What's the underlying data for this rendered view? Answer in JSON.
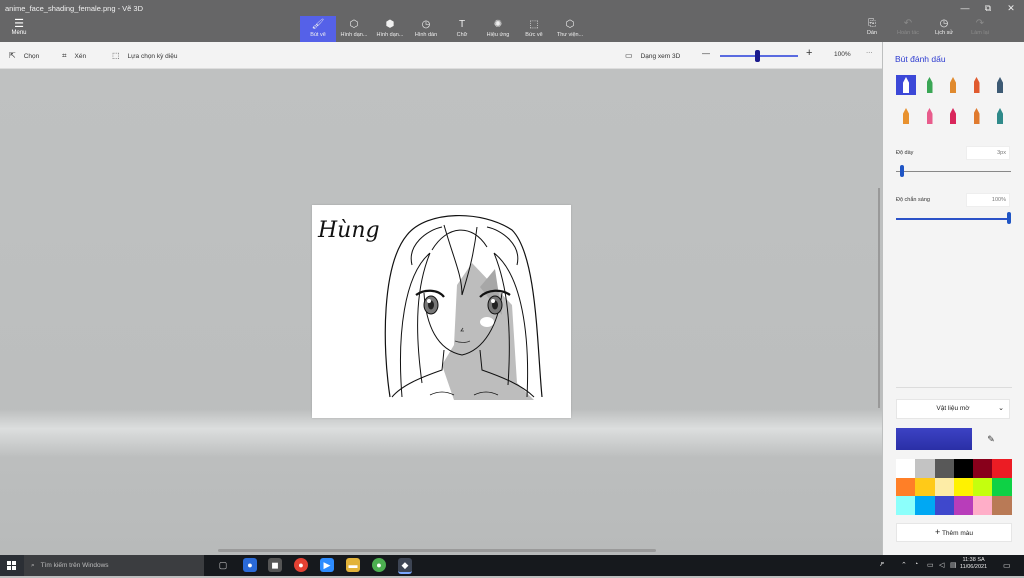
{
  "window": {
    "title": "anime_face_shading_female.png - Vẽ 3D"
  },
  "window_controls": [
    "—",
    "⧉",
    "✕"
  ],
  "menu": {
    "label": "Menu"
  },
  "tools": [
    {
      "label": "Bút vẽ",
      "icon": "brush-icon",
      "glyph": "🖌"
    },
    {
      "label": "Hình dạn...",
      "icon": "shapes-2d-icon",
      "glyph": "⬡"
    },
    {
      "label": "Hình dạn...",
      "icon": "shapes-3d-icon",
      "glyph": "⬢"
    },
    {
      "label": "Hình dán",
      "icon": "stickers-icon",
      "glyph": "◷"
    },
    {
      "label": "Chữ",
      "icon": "text-icon",
      "glyph": "T"
    },
    {
      "label": "Hiệu ứng",
      "icon": "effects-icon",
      "glyph": "✺"
    },
    {
      "label": "Bức vẽ",
      "icon": "canvas-icon",
      "glyph": "⬚"
    },
    {
      "label": "Thư viện...",
      "icon": "library-icon",
      "glyph": "⬡"
    }
  ],
  "right_tools": [
    {
      "label": "Dán",
      "icon": "paste-icon",
      "glyph": "⎘"
    },
    {
      "label": "Hoàn tác",
      "icon": "undo-icon",
      "glyph": "↶"
    },
    {
      "label": "Lịch sử",
      "icon": "history-icon",
      "glyph": "◷"
    },
    {
      "label": "Làm lại",
      "icon": "redo-icon",
      "glyph": "↷"
    }
  ],
  "toolbar2": {
    "select": "Chọn",
    "crop": "Xén",
    "magic_select": "Lựa chọn kỳ diệu",
    "view3d": "Dạng xem 3D",
    "zoom_minus": "—",
    "zoom_plus": "+",
    "zoom": "100%",
    "more": "···"
  },
  "zoom_slider": {
    "value": 0.47
  },
  "canvas": {
    "signature": "Hùng"
  },
  "panel": {
    "title": "Bút đánh dấu",
    "brushes": [
      {
        "name": "marker-brush",
        "color": "#3c48d8"
      },
      {
        "name": "calligraphy-pen",
        "color": "#3aa655"
      },
      {
        "name": "oil-brush",
        "color": "#e08a2e"
      },
      {
        "name": "watercolor-brush",
        "color": "#e05a2e"
      },
      {
        "name": "pixel-pen",
        "color": "#3d5a74"
      },
      {
        "name": "pencil",
        "color": "#e8912e"
      },
      {
        "name": "eraser",
        "color": "#e85c8c"
      },
      {
        "name": "crayon",
        "color": "#d9265b"
      },
      {
        "name": "spray-can",
        "color": "#e07a2e"
      },
      {
        "name": "fill-bucket",
        "color": "#2f8a8a"
      }
    ],
    "thickness_label": "Độ dày",
    "thickness_value": "3px",
    "thickness_fraction": 0.05,
    "opacity_label": "Độ chắn sáng",
    "opacity_value": "100%",
    "opacity_fraction": 1.0,
    "material_label": "Vật liệu mờ",
    "current_color": "#3c42c4",
    "swatches": [
      "#ffffff",
      "#c3c3c3",
      "#585858",
      "#000000",
      "#88001b",
      "#ec1c24",
      "#ff7f27",
      "#ffca18",
      "#fdeca6",
      "#fff200",
      "#c4ff0e",
      "#0ed145",
      "#8cfffb",
      "#00a8f3",
      "#3f48cc",
      "#b83dba",
      "#ffaec8",
      "#b97a56"
    ],
    "add_color": "Thêm màu"
  },
  "taskbar": {
    "search_placeholder": "Tìm kiếm trên Windows",
    "time": "11:38 SA",
    "date": "11/06/2021"
  }
}
